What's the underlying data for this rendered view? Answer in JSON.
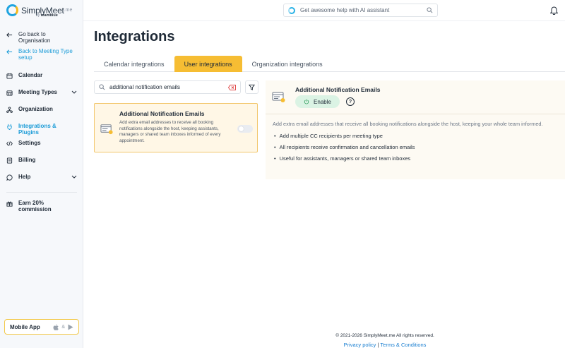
{
  "app": {
    "brand_name": "SimplyMeet",
    "brand_suffix": ".me",
    "brand_by": "by",
    "brand_parent": "teamblue"
  },
  "topbar": {
    "ai_placeholder": "Get awesome help with AI assistant"
  },
  "sidebar": {
    "back_org": "Go back to Organisation",
    "back_meeting": "Back to Meeting Type setup",
    "items": [
      {
        "label": "Calendar"
      },
      {
        "label": "Meeting Types"
      },
      {
        "label": "Organization"
      },
      {
        "label": "Integrations & Plugins"
      },
      {
        "label": "Settings"
      },
      {
        "label": "Billing"
      },
      {
        "label": "Help"
      }
    ],
    "earn": "Earn 20% commission",
    "mobile_app": "Mobile App",
    "mobile_and": "&"
  },
  "main": {
    "title": "Integrations",
    "tabs": [
      {
        "label": "Calendar integrations"
      },
      {
        "label": "User integrations"
      },
      {
        "label": "Organization integrations"
      }
    ],
    "search_value": "additional notification emails",
    "card": {
      "title": "Additional Notification Emails",
      "description": "Add extra email addresses to receive all booking notifications alongside the host, keeping assistants, managers or shared team inboxes informed of every appointment.",
      "enabled": false
    },
    "detail": {
      "title": "Additional Notification Emails",
      "enable_label": "Enable",
      "help_label": "?",
      "description": "Add extra email addresses that receive all booking notifications alongside the host, keeping your whole team informed.",
      "bullets": [
        "Add multiple CC recipients per meeting type",
        "All recipients receive confirmation and cancellation emails",
        "Useful for assistants, managers or shared team inboxes"
      ]
    }
  },
  "footer": {
    "copyright": "© 2021-2026 SimplyMeet.me All rights reserved.",
    "privacy": "Privacy policy",
    "separator": "|",
    "terms": "Terms & Conditions"
  },
  "colors": {
    "accent": "#f6bd33",
    "link": "#1a9bd7",
    "enable_bg": "#dbf3e4",
    "card_bg": "#fff7e6"
  }
}
